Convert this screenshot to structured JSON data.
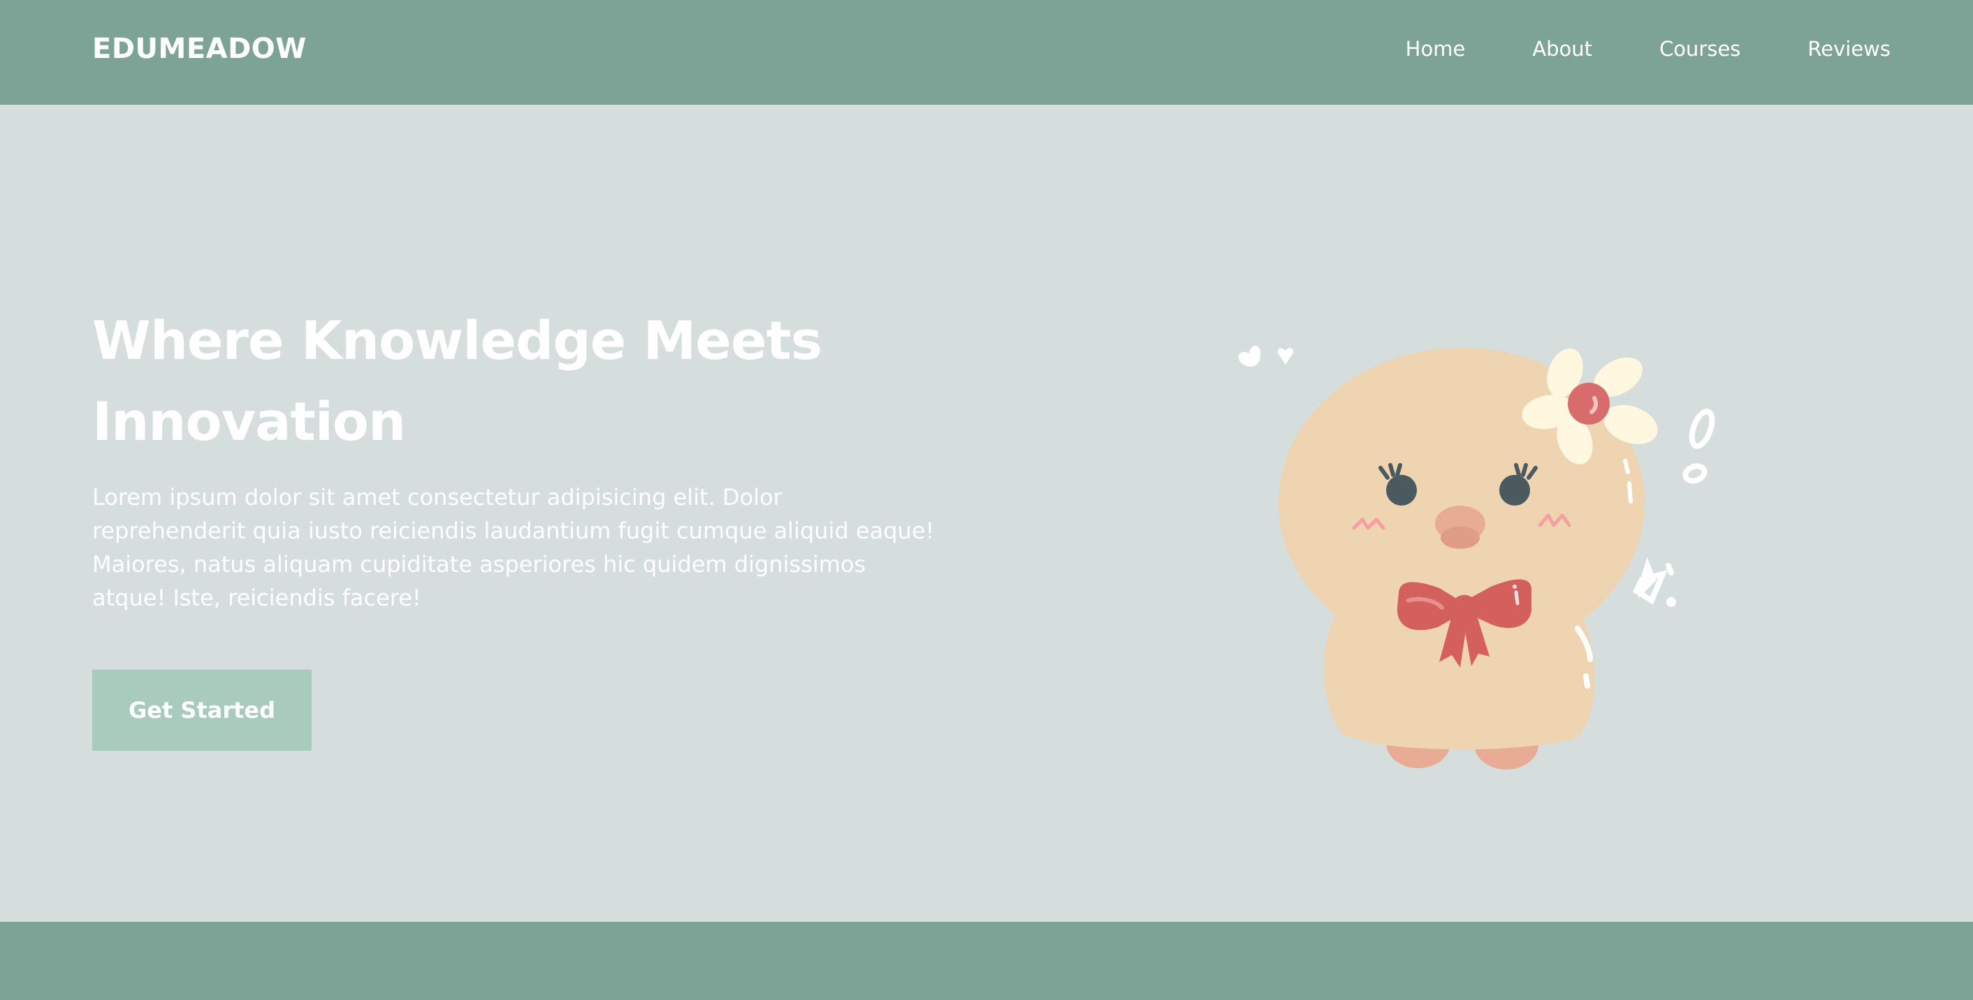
{
  "header": {
    "brand": "EDUMEADOW",
    "nav": [
      {
        "label": "Home"
      },
      {
        "label": "About"
      },
      {
        "label": "Courses"
      },
      {
        "label": "Reviews"
      }
    ]
  },
  "hero": {
    "title": "Where Knowledge Meets Innovation",
    "body": "Lorem ipsum dolor sit amet consectetur adipisicing elit. Dolor reprehenderit quia iusto reiciendis laudantium fugit cumque aliquid eaque! Maiores, natus aliquam cupiditate asperiores hic quidem dignissimos atque! Iste, reiciendis facere!",
    "cta_label": "Get Started"
  },
  "colors": {
    "header_bg": "#7da296",
    "page_bg": "#d5dedc",
    "cta_bg": "#a8cbbe",
    "text": "#ffffff"
  },
  "illustration": {
    "subject": "plush-chick-with-flower-and-bow"
  }
}
